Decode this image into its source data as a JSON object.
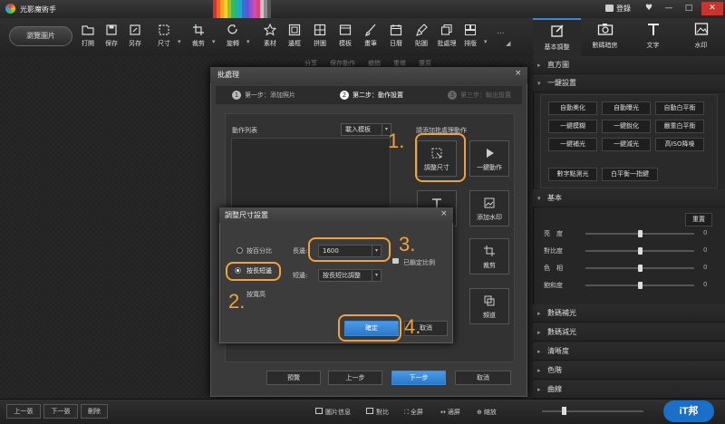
{
  "app": {
    "title": "光影魔術手",
    "login": "登錄",
    "win_controls": [
      "♥",
      "—",
      "□",
      "✕"
    ]
  },
  "palette": [
    "#d9302c",
    "#f06a1a",
    "#f5a623",
    "#f7d21c",
    "#8cc63f",
    "#2ebf5a",
    "#1bb3a5",
    "#2a9fd6",
    "#3370d8",
    "#6a4fd0",
    "#a34ad0",
    "#d84aa0",
    "#e83e6c",
    "#c8c8c8",
    "#8a8a8a",
    "#555555"
  ],
  "toolbar": {
    "browse": "瀏覽圖片",
    "tools": [
      {
        "label": "打開",
        "icon": "folder-open-icon"
      },
      {
        "label": "保存",
        "icon": "save-icon"
      },
      {
        "label": "另存",
        "icon": "save-as-icon"
      },
      {
        "label": "尺寸",
        "icon": "resize-icon"
      },
      {
        "label": "裁剪",
        "icon": "crop-icon"
      },
      {
        "label": "旋轉",
        "icon": "rotate-icon"
      },
      {
        "label": "素材",
        "icon": "material-icon"
      },
      {
        "label": "邊框",
        "icon": "frame-icon"
      },
      {
        "label": "拼圖",
        "icon": "collage-icon"
      },
      {
        "label": "模板",
        "icon": "template-icon"
      },
      {
        "label": "畫筆",
        "icon": "brush-icon"
      },
      {
        "label": "日曆",
        "icon": "calendar-icon"
      },
      {
        "label": "貼圖",
        "icon": "sticker-icon"
      },
      {
        "label": "批處理",
        "icon": "batch-icon"
      },
      {
        "label": "排版",
        "icon": "layout-icon"
      }
    ],
    "more": "..."
  },
  "right_tabs": [
    {
      "label": "基本調整",
      "icon": "edit-icon",
      "active": true
    },
    {
      "label": "數碼暗房",
      "icon": "camera-icon",
      "active": false
    },
    {
      "label": "文字",
      "icon": "text-icon",
      "active": false
    },
    {
      "label": "水印",
      "icon": "watermark-icon",
      "active": false
    }
  ],
  "subtoolbar": [
    "分享",
    "保存動作",
    "撤銷",
    "重做",
    "還原"
  ],
  "right_panel": {
    "histogram": "直方圖",
    "one_click": "一鍵設置",
    "one_click_buttons": [
      "自動美化",
      "自動曝光",
      "自動白平衡",
      "一鍵模糊",
      "一鍵銳化",
      "嚴重白平衡",
      "一鍵補光",
      "一鍵減光",
      "高ISO降噪"
    ],
    "extra_buttons": [
      "數字點測光",
      "白平衡一指鍵"
    ],
    "basic": "基本",
    "reset": "重置",
    "sliders": [
      {
        "name": "亮　度",
        "value": "0"
      },
      {
        "name": "對比度",
        "value": "0"
      },
      {
        "name": "色　相",
        "value": "0"
      },
      {
        "name": "飽和度",
        "value": "0"
      }
    ],
    "sections": [
      "數碼補光",
      "數碼減光",
      "清晰度",
      "色階",
      "曲線"
    ]
  },
  "batch": {
    "title": "批處理",
    "steps": [
      {
        "num": "1",
        "label": "第一步：添加照片"
      },
      {
        "num": "2",
        "label": "第二步：動作設置"
      },
      {
        "num": "3",
        "label": "第三步：輸出設置"
      }
    ],
    "action_list": "動作列表",
    "load_template": "載入模板",
    "add_hint": "請添加批處理動作",
    "actions": [
      "調整尺寸",
      "一鍵動作",
      "文字",
      "添加水印",
      "裁剪",
      "頻道"
    ],
    "footer": [
      "預覽",
      "上一步",
      "下一步",
      "取消"
    ]
  },
  "resize": {
    "title": "調整尺寸設置",
    "close": "×",
    "radio_percent": "按百分比",
    "radio_long_short": "按長短邊",
    "radio_wh": "按寬高",
    "long_side_label": "長邊:",
    "long_side_value": "1600",
    "short_side_label": "短邊:",
    "short_side_value": "按長短比調整",
    "lock_ratio": "已鎖定比例",
    "ok": "確定",
    "cancel": "取消"
  },
  "annotations": [
    "1.",
    "2.",
    "3.",
    "4."
  ],
  "statusbar": {
    "buttons": [
      "上一張",
      "下一張",
      "刪除"
    ],
    "items": [
      "圖片信息",
      "對比",
      "全屏",
      "適屏",
      "縮放"
    ]
  }
}
